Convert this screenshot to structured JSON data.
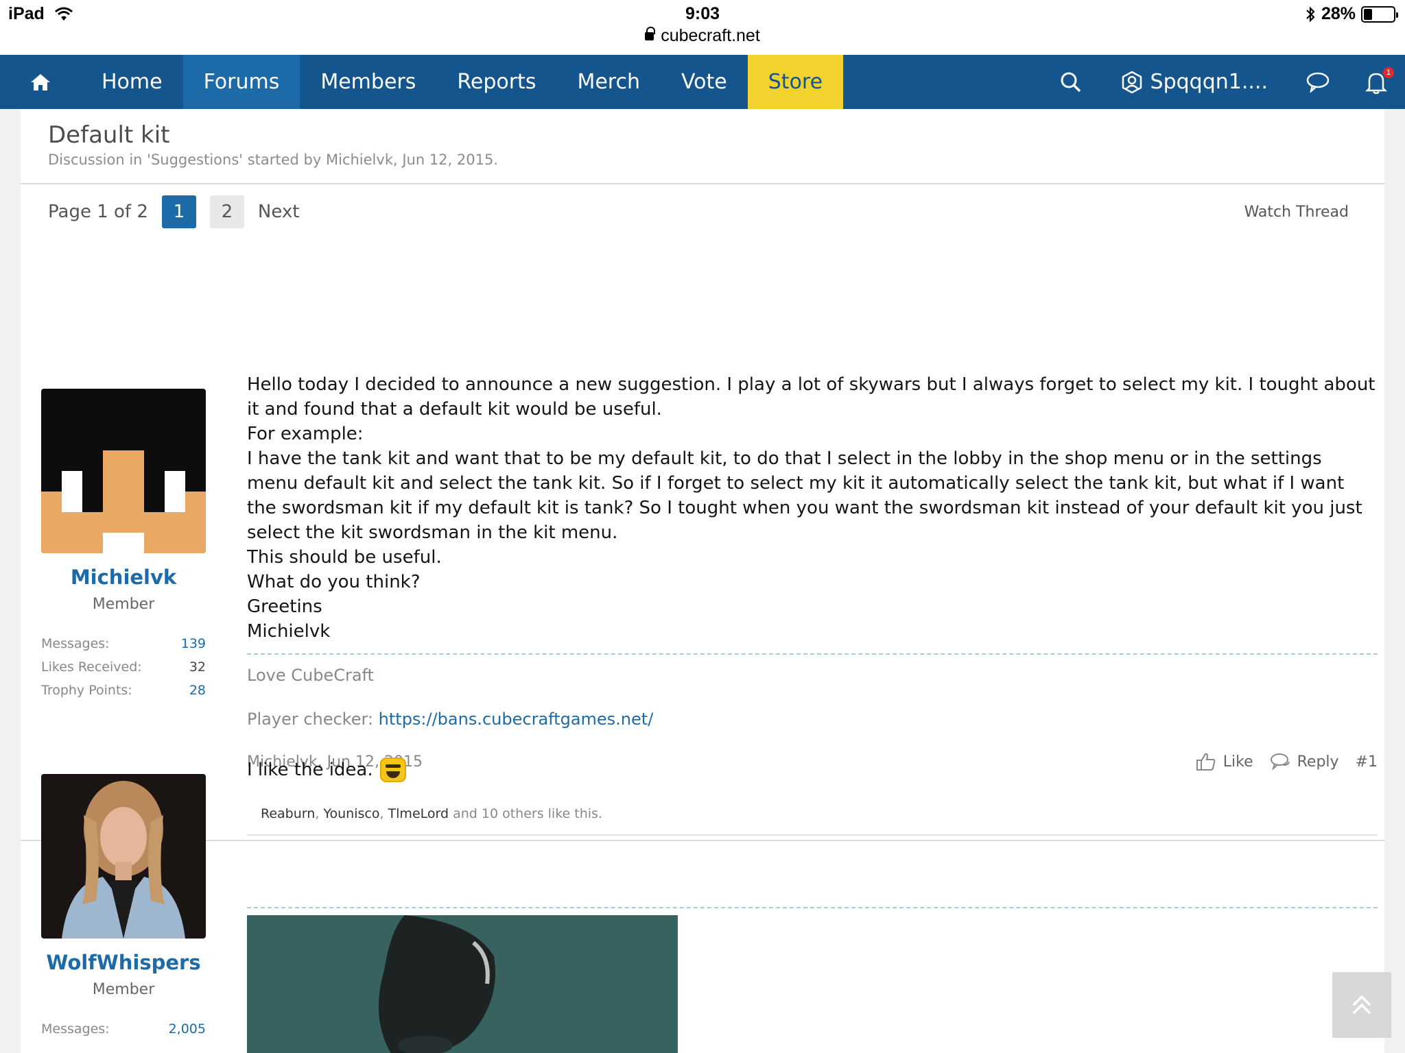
{
  "status_bar": {
    "device": "iPad",
    "time": "9:03",
    "url": "cubecraft.net",
    "battery": "28%",
    "battery_level": 0.28
  },
  "nav": {
    "items": [
      {
        "label": "Home"
      },
      {
        "label": "Forums"
      },
      {
        "label": "Members"
      },
      {
        "label": "Reports"
      },
      {
        "label": "Merch"
      },
      {
        "label": "Vote"
      },
      {
        "label": "Store"
      }
    ],
    "username": "Spqqqn1....",
    "alerts_count": "1"
  },
  "thread": {
    "title": "Default kit",
    "meta": "Discussion in 'Suggestions' started by Michielvk, Jun 12, 2015.",
    "page_info": "Page 1 of 2",
    "pages": [
      "1",
      "2"
    ],
    "next_label": "Next",
    "watch_label": "Watch Thread"
  },
  "posts": [
    {
      "username": "Michielvk",
      "user_title": "Member",
      "stats": {
        "messages_label": "Messages:",
        "messages": "139",
        "likes_label": "Likes Received:",
        "likes": "32",
        "trophy_label": "Trophy Points:",
        "trophy": "28"
      },
      "body": [
        "Hello today I decided to announce a new suggestion. I play a lot of skywars but I always forget to select my kit. I tought about it and found that a default kit would be useful.",
        "For example:",
        "I have the tank kit and want that to be my default kit, to do that I select in the lobby in the shop menu or in the settings menu default kit and select the tank kit. So if I forget to select my kit it automatically select the tank kit, but what if I want the swordsman kit if my default kit is tank? So I tought when you want the swordsman kit instead of your default kit you just select the kit swordsman in the kit menu.",
        "This should be useful.",
        "What do you think?",
        "Greetins",
        "Michielvk"
      ],
      "signature_line1": "Love CubeCraft",
      "signature_label": "Player checker: ",
      "signature_link": "https://bans.cubecraftgames.net/",
      "footer_author_date": "Michielvk, Jun 12, 2015",
      "like_label": "Like",
      "reply_label": "Reply",
      "post_number": "#1",
      "likes_users": [
        "Reaburn",
        "Younisco",
        "TlmeLord"
      ],
      "likes_suffix": "and 10 others like this."
    },
    {
      "username": "WolfWhispers",
      "user_title": "Member",
      "stats": {
        "messages_label": "Messages:",
        "messages": "2,005"
      },
      "body": "I like the idea."
    }
  ]
}
